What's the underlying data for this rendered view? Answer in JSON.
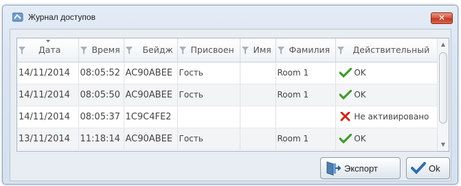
{
  "window": {
    "title": "Журнал доступов",
    "close_label": "✕"
  },
  "table": {
    "columns": [
      "Дата",
      "Время",
      "Бейдж",
      "Присвоен",
      "Имя",
      "Фамилия",
      "Действительный"
    ],
    "rows": [
      {
        "date": "14/11/2014",
        "time": "08:05:52",
        "badge": "AC90ABEE",
        "assigned": "Гость",
        "name": "",
        "surname": "Room 1",
        "status_icon": "check-icon",
        "status": "OK"
      },
      {
        "date": "14/11/2014",
        "time": "08:05:50",
        "badge": "AC90ABEE",
        "assigned": "Гость",
        "name": "",
        "surname": "Room 1",
        "status_icon": "check-icon",
        "status": "OK"
      },
      {
        "date": "14/11/2014",
        "time": "08:05:37",
        "badge": "1C9C4FE2",
        "assigned": "",
        "name": "",
        "surname": "",
        "status_icon": "cross-icon",
        "status": "Не активировано"
      },
      {
        "date": "13/11/2014",
        "time": "11:18:14",
        "badge": "AC90ABEE",
        "assigned": "Гость",
        "name": "",
        "surname": "Room 1",
        "status_icon": "check-icon",
        "status": "OK"
      }
    ]
  },
  "buttons": {
    "export_label": "Экспорт",
    "ok_label": "Ok"
  },
  "colors": {
    "ok_green": "#3f9d2b",
    "error_red": "#d0231c",
    "close_red": "#c13a22"
  }
}
